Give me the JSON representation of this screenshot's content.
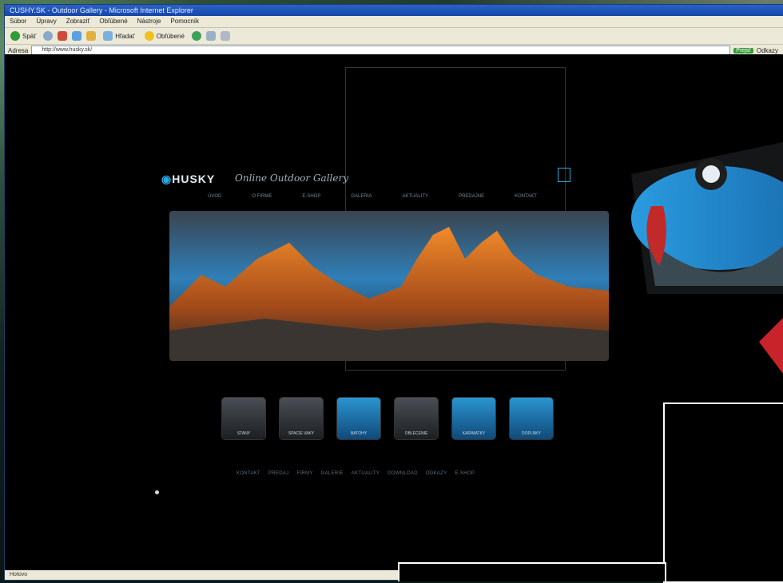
{
  "window": {
    "title": "CUSHY.SK - Outdoor Gallery - Microsoft Internet Explorer",
    "menu": [
      "Súbor",
      "Úpravy",
      "Zobraziť",
      "Obľúbené",
      "Nástroje",
      "Pomocník"
    ],
    "toolbar": {
      "back": "Späť",
      "search": "Hľadať",
      "favorites": "Obľúbené"
    },
    "address_label": "Adresa",
    "address_value": "http://www.husky.sk/",
    "go_label": "Prejsť",
    "links_label": "Odkazy",
    "status": "Hotovo"
  },
  "site": {
    "logo": "HUSKY",
    "tagline": "Online Outdoor Gallery",
    "nav": [
      "ÚVOD",
      "O FIRME",
      "E-SHOP",
      "GALERIA",
      "AKTUALITY",
      "PREDAJNE",
      "KONTAKT"
    ],
    "products": [
      {
        "label": "STANY"
      },
      {
        "label": "SPACIE VAKY"
      },
      {
        "label": "BATOHY"
      },
      {
        "label": "OBLECENIE"
      },
      {
        "label": "KARIMATKY"
      },
      {
        "label": "DOPLNKY"
      }
    ],
    "footer_links": [
      "KONTAKT",
      "PREDAJ",
      "FIRMY",
      "GALERIE",
      "AKTUALITY",
      "DOWNLOAD",
      "ODKAZY",
      "E-SHOP"
    ]
  },
  "colors": {
    "accent": "#29a8e0",
    "titlebar": "#1546a8",
    "chrome": "#ece9d8"
  }
}
